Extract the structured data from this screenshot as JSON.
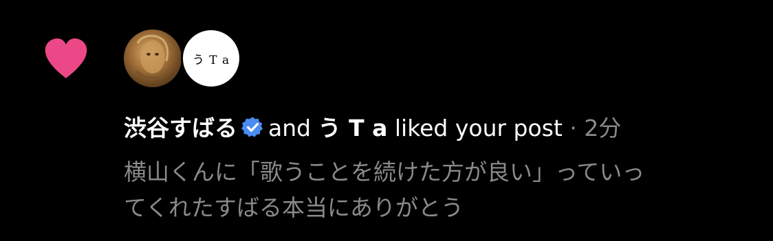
{
  "notification": {
    "type_icon": "heart-icon",
    "avatars": [
      {
        "name": "avatar-shibutani-subaru",
        "icon": "golden-portrait"
      },
      {
        "name": "avatar-u-ta",
        "text": "う T a"
      }
    ],
    "user1": "渋谷すばる",
    "verified": true,
    "connector": "and",
    "user2": "う T a",
    "action": "liked your post",
    "separator": "·",
    "time": "2分",
    "post_preview_line1": "横山くんに「歌うことを続けた方が良い」っていっ",
    "post_preview_line2": "てくれたすばる本当にありがとう"
  },
  "colors": {
    "background": "#000000",
    "heart": "#ec4887",
    "verified": "#4a8cf0",
    "primary_text": "#ffffff",
    "secondary_text": "#8a8a8a"
  }
}
